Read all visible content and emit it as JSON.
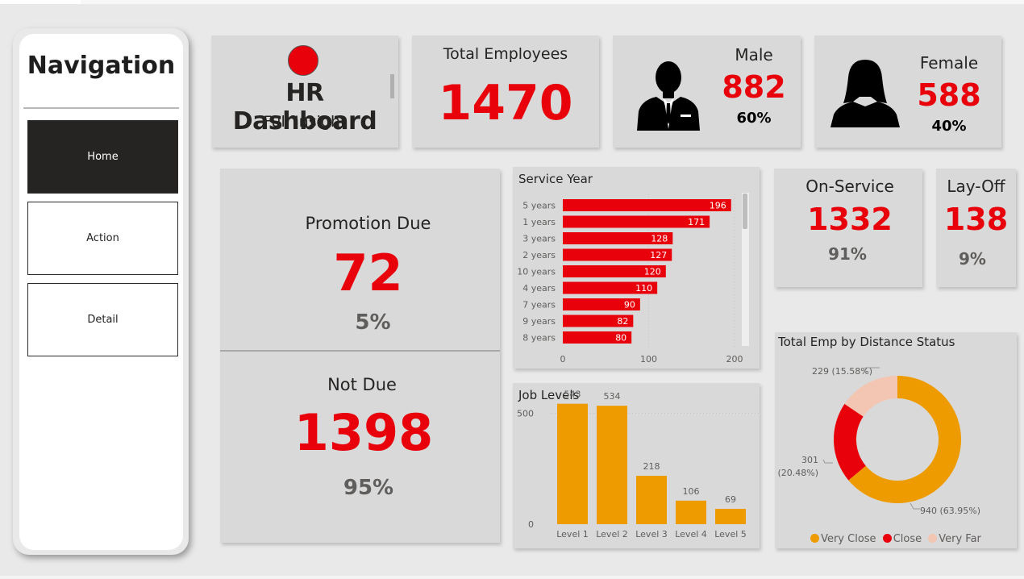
{
  "nav": {
    "title": "Navigation",
    "buttons": [
      {
        "label": "Home",
        "active": true
      },
      {
        "label": "Action",
        "active": false
      },
      {
        "label": "Detail",
        "active": false
      }
    ]
  },
  "header": {
    "title": "HR Dashboard",
    "subtitle": "Full Insight",
    "logo_color": "#e8000b"
  },
  "kpi": {
    "total": {
      "label": "Total Employees",
      "value": "1470"
    },
    "male": {
      "label": "Male",
      "value": "882",
      "pct": "60%"
    },
    "female": {
      "label": "Female",
      "value": "588",
      "pct": "40%"
    },
    "promotion_due": {
      "label": "Promotion Due",
      "value": "72",
      "pct": "5%"
    },
    "not_due": {
      "label": "Not Due",
      "value": "1398",
      "pct": "95%"
    },
    "on_service": {
      "label": "On-Service",
      "value": "1332",
      "pct": "91%"
    },
    "lay_off": {
      "label": "Lay-Off",
      "value": "138",
      "pct": "9%"
    }
  },
  "colors": {
    "accent": "#e8000b",
    "orange": "#ee9b00",
    "close": "#e8000b",
    "very_far": "#f3c6b3",
    "pct_gray": "#605e5c"
  },
  "chart_data": [
    {
      "type": "bar",
      "orientation": "horizontal",
      "title": "Service Year",
      "categories": [
        "5 years",
        "1 years",
        "3 years",
        "2 years",
        "10 years",
        "4 years",
        "7 years",
        "9 years",
        "8 years"
      ],
      "values": [
        196,
        171,
        128,
        127,
        120,
        110,
        90,
        82,
        80
      ],
      "xlim": [
        0,
        200
      ],
      "xticks": [
        "0",
        "100",
        "200"
      ],
      "color": "#e8000b"
    },
    {
      "type": "bar",
      "title": "Job Levels",
      "categories": [
        "Level 1",
        "Level 2",
        "Level 3",
        "Level 4",
        "Level 5"
      ],
      "values": [
        543,
        534,
        218,
        106,
        69
      ],
      "ylim": [
        0,
        600
      ],
      "yticks": [
        "0",
        "500"
      ],
      "color": "#ee9b00"
    },
    {
      "type": "pie",
      "donut": true,
      "title": "Total Emp by Distance Status",
      "slices": [
        {
          "name": "Very Close",
          "value": 940,
          "label": "940 (63.95%)",
          "color": "#ee9b00"
        },
        {
          "name": "Close",
          "value": 301,
          "label": "301 (20.48%)",
          "color": "#e8000b"
        },
        {
          "name": "Very Far",
          "value": 229,
          "label": "229 (15.58%)",
          "color": "#f3c6b3"
        }
      ],
      "legend": "bottom"
    }
  ]
}
